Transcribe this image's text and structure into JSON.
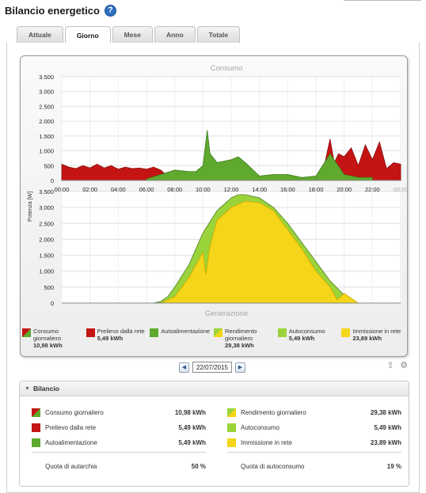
{
  "header": {
    "title": "Bilancio energetico",
    "help_icon": "question-icon"
  },
  "tabs": [
    {
      "label": "Attuale",
      "active": false
    },
    {
      "label": "Giorno",
      "active": true
    },
    {
      "label": "Mese",
      "active": false
    },
    {
      "label": "Anno",
      "active": false
    },
    {
      "label": "Totale",
      "active": false
    }
  ],
  "chart": {
    "top_title": "Consumo",
    "bottom_title": "Generazione",
    "ylabel": "Potenza [W]"
  },
  "colors": {
    "prelievo_red": "#c41414",
    "autoalimentazione_green": "#5ea92e",
    "autoconsumo_lightgreen": "#9bd43a",
    "immissione_yellow": "#f5d519"
  },
  "chart_data": [
    {
      "type": "area",
      "title": "Consumo",
      "ylabel": "Potenza [W]",
      "ylim": [
        0,
        3500
      ],
      "yticks": [
        "3.500",
        "3.000",
        "2.500",
        "2.000",
        "1.500",
        "1.000",
        "500",
        "0"
      ],
      "xticks": [
        "00:00",
        "02:00",
        "04:00",
        "06:00",
        "08:00",
        "10:00",
        "12:00",
        "14:00",
        "16:00",
        "18:00",
        "20:00",
        "22:00",
        "00:00"
      ],
      "grid": true,
      "series": [
        {
          "name": "Prelievo dalla rete",
          "x": [
            0,
            0.5,
            1,
            1.5,
            2,
            2.5,
            3,
            3.5,
            4,
            4.5,
            5,
            5.5,
            6,
            6.5,
            7,
            7.5,
            8,
            9,
            10,
            11,
            12,
            13,
            14,
            15,
            16,
            17,
            18,
            18.5,
            19,
            19.3,
            19.6,
            20,
            20.5,
            21,
            21.5,
            22,
            22.5,
            23,
            23.5,
            24
          ],
          "values": [
            550,
            450,
            400,
            500,
            420,
            550,
            420,
            500,
            380,
            450,
            400,
            420,
            380,
            450,
            350,
            150,
            80,
            50,
            0,
            0,
            0,
            0,
            30,
            60,
            80,
            50,
            150,
            300,
            1400,
            600,
            900,
            800,
            1100,
            500,
            1200,
            700,
            1300,
            400,
            600,
            550
          ]
        },
        {
          "name": "Autoalimentazione",
          "x": [
            6,
            7,
            8,
            9,
            9.5,
            10,
            10.3,
            10.5,
            11,
            12,
            12.5,
            13,
            14,
            15,
            16,
            17,
            18,
            19,
            20,
            21,
            22
          ],
          "values": [
            50,
            200,
            350,
            300,
            300,
            500,
            1700,
            900,
            600,
            700,
            800,
            600,
            150,
            200,
            200,
            100,
            150,
            900,
            200,
            100,
            100
          ]
        }
      ]
    },
    {
      "type": "area",
      "title": "Generazione",
      "ylim": [
        0,
        3500
      ],
      "yticks": [
        "3.500",
        "3.000",
        "2.500",
        "2.000",
        "1.500",
        "1.000",
        "500",
        "0"
      ],
      "grid": true,
      "series": [
        {
          "name": "Rendimento giornaliero",
          "x": [
            0,
            6.5,
            7,
            7.5,
            8,
            9,
            10,
            11,
            12,
            12.5,
            13,
            14,
            15,
            16,
            17,
            18,
            19,
            20,
            20.5,
            21,
            24
          ],
          "values": [
            0,
            0,
            50,
            200,
            500,
            1200,
            2200,
            2900,
            3300,
            3400,
            3400,
            3300,
            3000,
            2500,
            1900,
            1300,
            700,
            250,
            50,
            0,
            0
          ]
        },
        {
          "name": "Immissione in rete",
          "x": [
            0,
            7,
            8,
            9,
            10,
            10.2,
            10.5,
            11,
            12,
            13,
            14,
            15,
            16,
            17,
            18,
            19,
            19.5,
            20,
            21,
            24
          ],
          "values": [
            0,
            0,
            200,
            800,
            1600,
            900,
            1800,
            2600,
            3000,
            3200,
            3150,
            2900,
            2300,
            1700,
            1000,
            500,
            100,
            300,
            0,
            0
          ]
        }
      ]
    }
  ],
  "legend": [
    {
      "label": "Consumo giornaliero",
      "value": "10,98 kWh",
      "swatch": "diagonal-red-green"
    },
    {
      "label": "Prelievo dalla rete",
      "value": "5,49 kWh",
      "swatch": "#c41414"
    },
    {
      "label": "Autoalimentazione",
      "value": "",
      "swatch": "#5ea92e"
    },
    {
      "label": "Rendimento giornaliero",
      "value": "29,38 kWh",
      "swatch": "diagonal-lightgreen-yellow"
    },
    {
      "label": "Autoconsumo",
      "value": "5,49 kWh",
      "swatch": "#9bd43a"
    },
    {
      "label": "Immissione in rete",
      "value": "23,89 kWh",
      "swatch": "#f5d519"
    }
  ],
  "date_nav": {
    "date": "22/07/2015",
    "prev_icon": "arrow-left-icon",
    "next_icon": "arrow-right-icon"
  },
  "bilancio": {
    "title": "Bilancio",
    "left": [
      {
        "label": "Consumo giornaliero",
        "value": "10,98 kWh"
      },
      {
        "label": "Prelievo dalla rete",
        "value": "5,49 kWh"
      },
      {
        "label": "Autoalimentazione",
        "value": "5,49 kWh"
      }
    ],
    "left_quota": {
      "label": "Quota di autarchia",
      "value": "50 %"
    },
    "right": [
      {
        "label": "Rendimento giornaliero",
        "value": "29,38 kWh"
      },
      {
        "label": "Autoconsumo",
        "value": "5,49 kWh"
      },
      {
        "label": "Immissione in rete",
        "value": "23,89 kWh"
      }
    ],
    "right_quota": {
      "label": "Quota di autoconsumo",
      "value": "19 %"
    }
  }
}
